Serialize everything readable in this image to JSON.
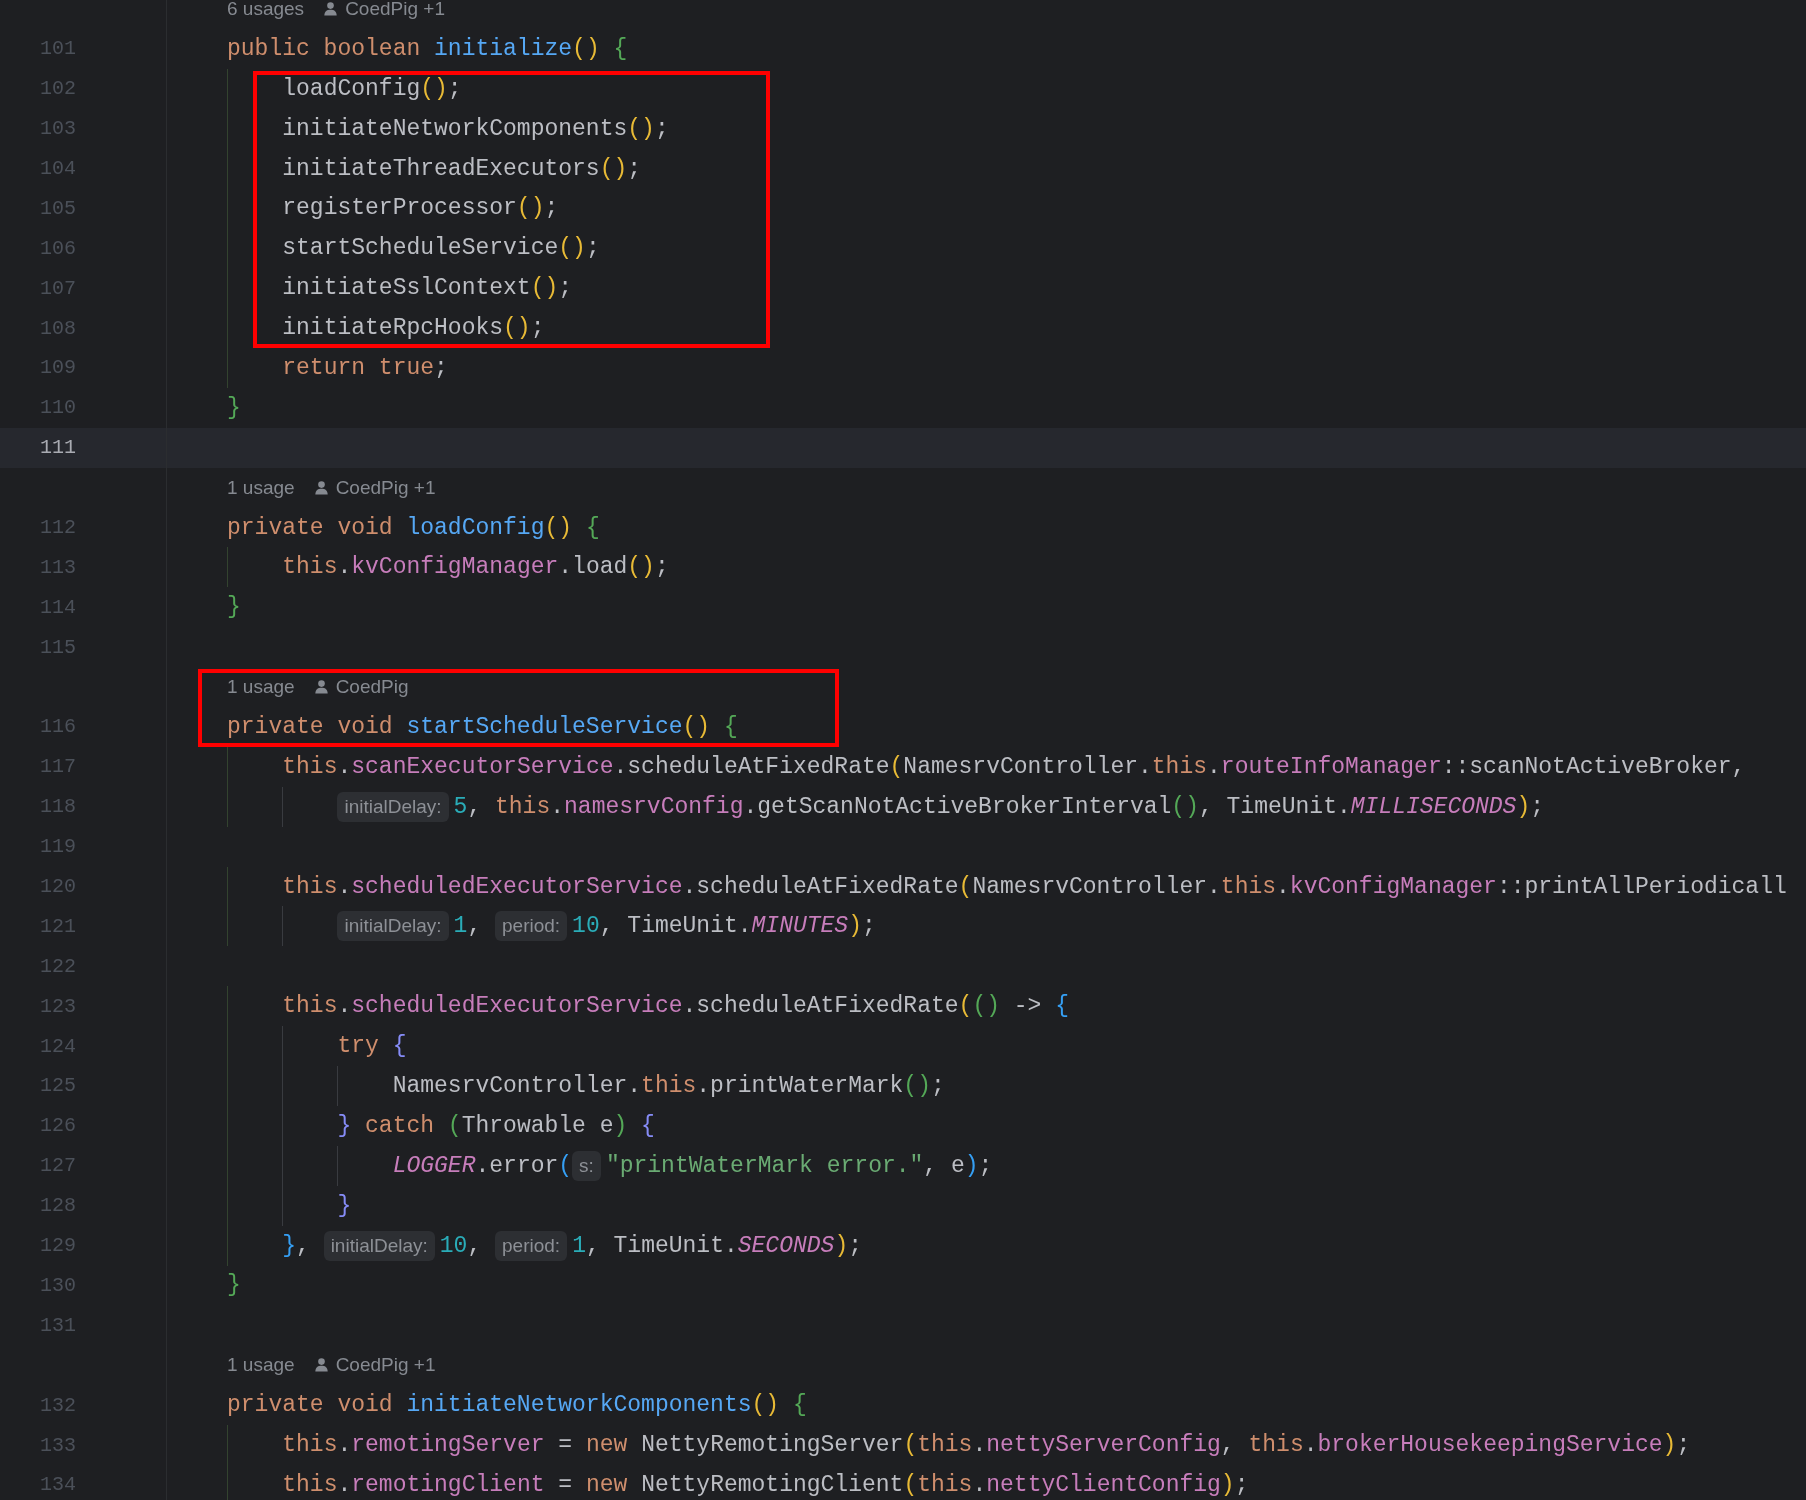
{
  "editor": {
    "rows": [
      {
        "kind": "usage",
        "usages": "6 usages",
        "author": "CoedPig +1"
      },
      {
        "kind": "code",
        "number": "101",
        "current": false,
        "tokens": [
          {
            "text": "public boolean ",
            "kind": "keyword"
          },
          {
            "text": "initialize",
            "kind": "declaration"
          },
          {
            "text": "()",
            "kind": "bracket",
            "color": "#e8ba36"
          },
          {
            "text": " {",
            "kind": "bracket",
            "color": "#54a857"
          }
        ]
      },
      {
        "kind": "highlight",
        "rows": [
          {
            "kind": "code",
            "number": "102",
            "current": false,
            "tokens": [
              {
                "text": "    loadConfig",
                "kind": "plain"
              },
              {
                "text": "()",
                "kind": "bracket",
                "color": "#e8ba36"
              },
              {
                "text": ";",
                "kind": "plain"
              }
            ]
          },
          {
            "kind": "code",
            "number": "103",
            "current": false,
            "tokens": [
              {
                "text": "    initiateNetworkComponents",
                "kind": "plain"
              },
              {
                "text": "()",
                "kind": "bracket",
                "color": "#e8ba36"
              },
              {
                "text": ";",
                "kind": "plain"
              }
            ]
          },
          {
            "kind": "code",
            "number": "104",
            "current": false,
            "tokens": [
              {
                "text": "    initiateThreadExecutors",
                "kind": "plain"
              },
              {
                "text": "()",
                "kind": "bracket",
                "color": "#e8ba36"
              },
              {
                "text": ";",
                "kind": "plain"
              }
            ]
          },
          {
            "kind": "code",
            "number": "105",
            "current": false,
            "tokens": [
              {
                "text": "    registerProcessor",
                "kind": "plain"
              },
              {
                "text": "()",
                "kind": "bracket",
                "color": "#e8ba36"
              },
              {
                "text": ";",
                "kind": "plain"
              }
            ]
          },
          {
            "kind": "code",
            "number": "106",
            "current": false,
            "tokens": [
              {
                "text": "    startScheduleService",
                "kind": "plain"
              },
              {
                "text": "()",
                "kind": "bracket",
                "color": "#e8ba36"
              },
              {
                "text": ";",
                "kind": "plain"
              }
            ]
          },
          {
            "kind": "code",
            "number": "107",
            "current": false,
            "tokens": [
              {
                "text": "    initiateSslContext",
                "kind": "plain"
              },
              {
                "text": "()",
                "kind": "bracket",
                "color": "#e8ba36"
              },
              {
                "text": ";",
                "kind": "plain"
              }
            ]
          },
          {
            "kind": "code",
            "number": "108",
            "current": false,
            "tokens": [
              {
                "text": "    initiateRpcHooks",
                "kind": "plain"
              },
              {
                "text": "()",
                "kind": "bracket",
                "color": "#e8ba36"
              },
              {
                "text": ";",
                "kind": "plain"
              }
            ]
          }
        ]
      },
      {
        "kind": "code",
        "number": "109",
        "current": false,
        "tokens": [
          {
            "text": "    return true",
            "kind": "keyword"
          },
          {
            "text": ";",
            "kind": "plain"
          }
        ]
      },
      {
        "kind": "code",
        "number": "110",
        "current": false,
        "tokens": [
          {
            "text": "}",
            "kind": "bracket",
            "color": "#54a857"
          }
        ]
      },
      {
        "kind": "code",
        "number": "111",
        "current": true
      },
      {
        "kind": "usage",
        "usages": "1 usage",
        "author": "CoedPig +1"
      },
      {
        "kind": "code",
        "number": "112",
        "current": false,
        "tokens": [
          {
            "text": "private void ",
            "kind": "keyword"
          },
          {
            "text": "loadConfig",
            "kind": "declaration"
          },
          {
            "text": "()",
            "kind": "bracket",
            "color": "#e8ba36"
          },
          {
            "text": " {",
            "kind": "bracket",
            "color": "#54a857"
          }
        ]
      },
      {
        "kind": "code",
        "number": "113",
        "current": false,
        "tokens": [
          {
            "text": "    this",
            "kind": "keyword"
          },
          {
            "text": ".",
            "kind": "plain"
          },
          {
            "text": "kvConfigManager",
            "kind": "field"
          },
          {
            "text": ".load",
            "kind": "plain"
          },
          {
            "text": "()",
            "kind": "bracket",
            "color": "#e8ba36"
          },
          {
            "text": ";",
            "kind": "plain"
          }
        ]
      },
      {
        "kind": "code",
        "number": "114",
        "current": false,
        "tokens": [
          {
            "text": "}",
            "kind": "bracket",
            "color": "#54a857"
          }
        ]
      },
      {
        "kind": "code",
        "number": "115",
        "current": false
      },
      {
        "kind": "highlight",
        "rows": [
          {
            "kind": "usage",
            "usages": "1 usage",
            "author": "CoedPig"
          },
          {
            "kind": "code",
            "number": "116",
            "current": false,
            "tokens": [
              {
                "text": "private void ",
                "kind": "keyword"
              },
              {
                "text": "startScheduleService",
                "kind": "declaration"
              },
              {
                "text": "()",
                "kind": "bracket",
                "color": "#e8ba36"
              },
              {
                "text": " {",
                "kind": "bracket",
                "color": "#54a857"
              }
            ]
          }
        ]
      },
      {
        "kind": "code",
        "number": "117",
        "current": false,
        "tokens": [
          {
            "text": "    this",
            "kind": "keyword"
          },
          {
            "text": ".",
            "kind": "plain"
          },
          {
            "text": "scanExecutorService",
            "kind": "field"
          },
          {
            "text": ".scheduleAtFixedRate",
            "kind": "plain"
          },
          {
            "text": "(",
            "kind": "bracket",
            "color": "#e8ba36"
          },
          {
            "text": "NamesrvController.",
            "kind": "plain"
          },
          {
            "text": "this",
            "kind": "keyword"
          },
          {
            "text": ".",
            "kind": "plain"
          },
          {
            "text": "routeInfoManager",
            "kind": "field"
          },
          {
            "text": "::scanNotActiveBroker,",
            "kind": "plain"
          }
        ]
      },
      {
        "kind": "code",
        "number": "118",
        "current": false,
        "tokens": [
          {
            "text": "        initialDelay:",
            "kind": "hint"
          },
          {
            "text": "5",
            "kind": "number"
          },
          {
            "text": ", ",
            "kind": "plain"
          },
          {
            "text": "this",
            "kind": "keyword"
          },
          {
            "text": ".",
            "kind": "plain"
          },
          {
            "text": "namesrvConfig",
            "kind": "field"
          },
          {
            "text": ".getScanNotActiveBrokerInterval",
            "kind": "plain"
          },
          {
            "text": "()",
            "kind": "bracket",
            "color": "#54a857"
          },
          {
            "text": ", TimeUnit.",
            "kind": "plain"
          },
          {
            "text": "MILLISECONDS",
            "kind": "constant"
          },
          {
            "text": ")",
            "kind": "bracket",
            "color": "#e8ba36"
          },
          {
            "text": ";",
            "kind": "plain"
          }
        ]
      },
      {
        "kind": "code",
        "number": "119",
        "current": false
      },
      {
        "kind": "code",
        "number": "120",
        "current": false,
        "tokens": [
          {
            "text": "    this",
            "kind": "keyword"
          },
          {
            "text": ".",
            "kind": "plain"
          },
          {
            "text": "scheduledExecutorService",
            "kind": "field"
          },
          {
            "text": ".scheduleAtFixedRate",
            "kind": "plain"
          },
          {
            "text": "(",
            "kind": "bracket",
            "color": "#e8ba36"
          },
          {
            "text": "NamesrvController.",
            "kind": "plain"
          },
          {
            "text": "this",
            "kind": "keyword"
          },
          {
            "text": ".",
            "kind": "plain"
          },
          {
            "text": "kvConfigManager",
            "kind": "field"
          },
          {
            "text": "::printAllPeriodicall",
            "kind": "plain"
          }
        ]
      },
      {
        "kind": "code",
        "number": "121",
        "current": false,
        "tokens": [
          {
            "text": "        initialDelay:",
            "kind": "hint"
          },
          {
            "text": "1",
            "kind": "number"
          },
          {
            "text": ", ",
            "kind": "plain"
          },
          {
            "text": "period:",
            "kind": "hint"
          },
          {
            "text": "10",
            "kind": "number"
          },
          {
            "text": ", TimeUnit.",
            "kind": "plain"
          },
          {
            "text": "MINUTES",
            "kind": "constant"
          },
          {
            "text": ")",
            "kind": "bracket",
            "color": "#e8ba36"
          },
          {
            "text": ";",
            "kind": "plain"
          }
        ]
      },
      {
        "kind": "code",
        "number": "122",
        "current": false
      },
      {
        "kind": "code",
        "number": "123",
        "current": false,
        "tokens": [
          {
            "text": "    this",
            "kind": "keyword"
          },
          {
            "text": ".",
            "kind": "plain"
          },
          {
            "text": "scheduledExecutorService",
            "kind": "field"
          },
          {
            "text": ".scheduleAtFixedRate",
            "kind": "plain"
          },
          {
            "text": "(",
            "kind": "bracket",
            "color": "#e8ba36"
          },
          {
            "text": "()",
            "kind": "bracket",
            "color": "#54a857"
          },
          {
            "text": " -> ",
            "kind": "plain"
          },
          {
            "text": "{",
            "kind": "bracket",
            "color": "#359ff4"
          }
        ]
      },
      {
        "kind": "code",
        "number": "124",
        "current": false,
        "tokens": [
          {
            "text": "        try",
            "kind": "keyword"
          },
          {
            "text": " {",
            "kind": "bracket",
            "color": "#868cf7"
          }
        ]
      },
      {
        "kind": "code",
        "number": "125",
        "current": false,
        "tokens": [
          {
            "text": "            NamesrvController.",
            "kind": "plain"
          },
          {
            "text": "this",
            "kind": "keyword"
          },
          {
            "text": ".printWaterMark",
            "kind": "plain"
          },
          {
            "text": "()",
            "kind": "bracket",
            "color": "#54a857"
          },
          {
            "text": ";",
            "kind": "plain"
          }
        ]
      },
      {
        "kind": "code",
        "number": "126",
        "current": false,
        "tokens": [
          {
            "text": "        }",
            "kind": "bracket",
            "color": "#868cf7"
          },
          {
            "text": " catch ",
            "kind": "keyword"
          },
          {
            "text": "(",
            "kind": "bracket",
            "color": "#54a857"
          },
          {
            "text": "Throwable e",
            "kind": "plain"
          },
          {
            "text": ")",
            "kind": "bracket",
            "color": "#54a857"
          },
          {
            "text": " {",
            "kind": "bracket",
            "color": "#868cf7"
          }
        ]
      },
      {
        "kind": "code",
        "number": "127",
        "current": false,
        "tokens": [
          {
            "text": "            LOGGER",
            "kind": "constant"
          },
          {
            "text": ".error",
            "kind": "plain"
          },
          {
            "text": "(",
            "kind": "bracket",
            "color": "#359ff4"
          },
          {
            "text": "s:",
            "kind": "hint"
          },
          {
            "text": "\"printWaterMark error.\"",
            "kind": "string"
          },
          {
            "text": ", e",
            "kind": "plain"
          },
          {
            "text": ")",
            "kind": "bracket",
            "color": "#359ff4"
          },
          {
            "text": ";",
            "kind": "plain"
          }
        ]
      },
      {
        "kind": "code",
        "number": "128",
        "current": false,
        "tokens": [
          {
            "text": "        }",
            "kind": "bracket",
            "color": "#868cf7"
          }
        ]
      },
      {
        "kind": "code",
        "number": "129",
        "current": false,
        "tokens": [
          {
            "text": "    }",
            "kind": "bracket",
            "color": "#359ff4"
          },
          {
            "text": ", ",
            "kind": "plain"
          },
          {
            "text": "initialDelay:",
            "kind": "hint"
          },
          {
            "text": "10",
            "kind": "number"
          },
          {
            "text": ", ",
            "kind": "plain"
          },
          {
            "text": "period:",
            "kind": "hint"
          },
          {
            "text": "1",
            "kind": "number"
          },
          {
            "text": ", TimeUnit.",
            "kind": "plain"
          },
          {
            "text": "SECONDS",
            "kind": "constant"
          },
          {
            "text": ")",
            "kind": "bracket",
            "color": "#e8ba36"
          },
          {
            "text": ";",
            "kind": "plain"
          }
        ]
      },
      {
        "kind": "code",
        "number": "130",
        "current": false,
        "tokens": [
          {
            "text": "}",
            "kind": "bracket",
            "color": "#54a857"
          }
        ]
      },
      {
        "kind": "code",
        "number": "131",
        "current": false
      },
      {
        "kind": "usage",
        "usages": "1 usage",
        "author": "CoedPig +1"
      },
      {
        "kind": "code",
        "number": "132",
        "current": false,
        "tokens": [
          {
            "text": "private void ",
            "kind": "keyword"
          },
          {
            "text": "initiateNetworkComponents",
            "kind": "declaration"
          },
          {
            "text": "()",
            "kind": "bracket",
            "color": "#e8ba36"
          },
          {
            "text": " {",
            "kind": "bracket",
            "color": "#54a857"
          }
        ]
      },
      {
        "kind": "code",
        "number": "133",
        "current": false,
        "tokens": [
          {
            "text": "    this",
            "kind": "keyword"
          },
          {
            "text": ".",
            "kind": "plain"
          },
          {
            "text": "remotingServer",
            "kind": "field"
          },
          {
            "text": " = ",
            "kind": "plain"
          },
          {
            "text": "new",
            "kind": "keyword"
          },
          {
            "text": " NettyRemotingServer",
            "kind": "plain"
          },
          {
            "text": "(",
            "kind": "bracket",
            "color": "#e8ba36"
          },
          {
            "text": "this",
            "kind": "keyword"
          },
          {
            "text": ".",
            "kind": "plain"
          },
          {
            "text": "nettyServerConfig",
            "kind": "field"
          },
          {
            "text": ", ",
            "kind": "plain"
          },
          {
            "text": "this",
            "kind": "keyword"
          },
          {
            "text": ".",
            "kind": "plain"
          },
          {
            "text": "brokerHousekeepingService",
            "kind": "field"
          },
          {
            "text": ")",
            "kind": "bracket",
            "color": "#e8ba36"
          },
          {
            "text": ";",
            "kind": "plain"
          }
        ]
      },
      {
        "kind": "code",
        "number": "134",
        "current": false,
        "tokens": [
          {
            "text": "    this",
            "kind": "keyword"
          },
          {
            "text": ".",
            "kind": "plain"
          },
          {
            "text": "remotingClient",
            "kind": "field"
          },
          {
            "text": " = ",
            "kind": "plain"
          },
          {
            "text": "new",
            "kind": "keyword"
          },
          {
            "text": " NettyRemotingClient",
            "kind": "plain"
          },
          {
            "text": "(",
            "kind": "bracket",
            "color": "#e8ba36"
          },
          {
            "text": "this",
            "kind": "keyword"
          },
          {
            "text": ".",
            "kind": "plain"
          },
          {
            "text": "nettyClientConfig",
            "kind": "field"
          },
          {
            "text": ")",
            "kind": "bracket",
            "color": "#e8ba36"
          },
          {
            "text": ";",
            "kind": "plain"
          }
        ]
      }
    ]
  }
}
